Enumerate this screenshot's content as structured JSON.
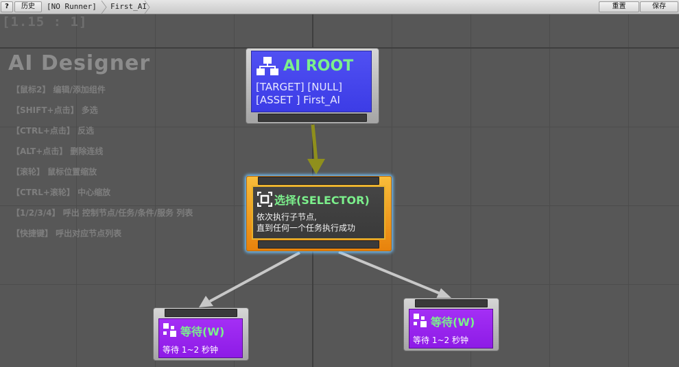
{
  "toolbar": {
    "help_label": "?",
    "history_label": "历史",
    "breadcrumb": [
      "[NO Runner]",
      "First_AI"
    ],
    "reset_label": "重置",
    "save_label": "保存"
  },
  "canvas": {
    "zoom_label": "[1.15 : 1]",
    "app_title": "AI Designer",
    "help_lines": [
      "【鼠标2】 编辑/添加组件",
      "【SHIFT+点击】 多选",
      "【CTRL+点击】 反选",
      "【ALT+点击】 删除连线",
      "【滚轮】 鼠标位置缩放",
      "【CTRL+滚轮】 中心缩放",
      "【1/2/3/4】 呼出 控制节点/任务/条件/服务 列表",
      "【快捷键】 呼出对应节点列表"
    ]
  },
  "nodes": {
    "root": {
      "title": "AI ROOT",
      "target_line": "[TARGET] [NULL]",
      "asset_line": "[ASSET ] First_AI",
      "icon": "hierarchy-icon",
      "color": "#4646ee"
    },
    "selector": {
      "title": "选择(SELECTOR)",
      "desc_line1": "依次执行子节点,",
      "desc_line2": "直到任何一个任务执行成功",
      "icon": "selector-icon",
      "color": "#f0a020"
    },
    "wait_left": {
      "title": "等待(W)",
      "desc": "等待 1~2 秒钟",
      "icon": "grid-icon",
      "color": "#9626f0"
    },
    "wait_right": {
      "title": "等待(W)",
      "desc": "等待 1~2 秒钟",
      "icon": "grid-icon",
      "color": "#9626f0"
    }
  },
  "connections": {
    "active_color": "#8f8f1c",
    "inactive_color": "#c8c8c8"
  }
}
